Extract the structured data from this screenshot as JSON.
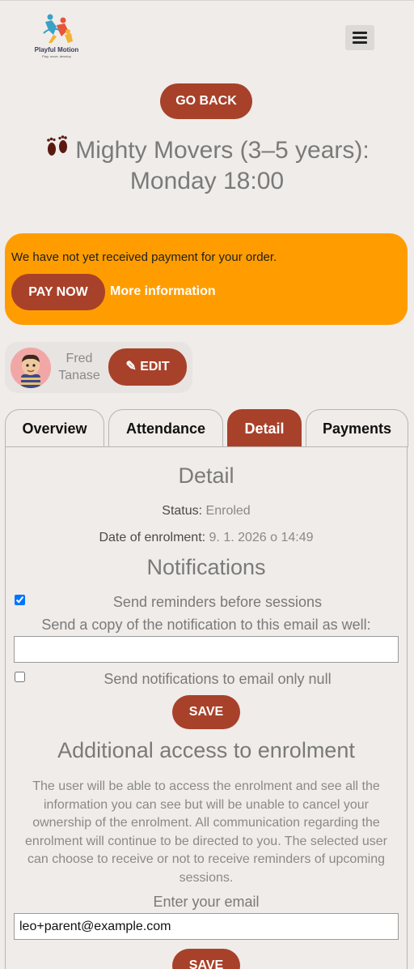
{
  "header": {
    "logo_title": "Playful Motion",
    "logo_tagline": "Play, move, develop",
    "menu_icon": "hamburger-icon"
  },
  "go_back_label": "GO BACK",
  "course": {
    "icon": "footprints-icon",
    "title": "Mighty Movers (3–5 years): Monday 18:00"
  },
  "payment_banner": {
    "message": "We have not yet received payment for your order.",
    "pay_now_label": "PAY NOW",
    "more_info_label": "More information",
    "background": "#ff9d00"
  },
  "participant": {
    "name": "Fred Tanase",
    "edit_label": "✎ EDIT"
  },
  "tabs": [
    {
      "label": "Overview",
      "active": false
    },
    {
      "label": "Attendance",
      "active": false
    },
    {
      "label": "Detail",
      "active": true
    },
    {
      "label": "Payments",
      "active": false
    }
  ],
  "detail": {
    "heading": "Detail",
    "status_label": "Status:",
    "status_value": "Enroled",
    "date_label": "Date of enrolment:",
    "date_value": "9. 1. 2026 o 14:49"
  },
  "notifications": {
    "heading": "Notifications",
    "reminders_label": "Send reminders before sessions",
    "reminders_checked": true,
    "copy_email_label": "Send a copy of the notification to this email as well:",
    "copy_email_value": "",
    "email_only_label": "Send notifications to email only null",
    "email_only_checked": false,
    "save_label": "SAVE"
  },
  "additional_access": {
    "heading": "Additional access to enrolment",
    "description": "The user will be able to access the enrolment and see all the information you can see but will be unable to cancel your ownership of the enrolment. All communication regarding the enrolment will continue to be directed to you. The selected user can choose to receive or not to receive reminders of upcoming sessions.",
    "email_label": "Enter your email",
    "email_value": "leo+parent@example.com",
    "save_label": "SAVE"
  },
  "colors": {
    "accent": "#a8412a",
    "background": "#f0ece9",
    "banner": "#ff9d00"
  }
}
